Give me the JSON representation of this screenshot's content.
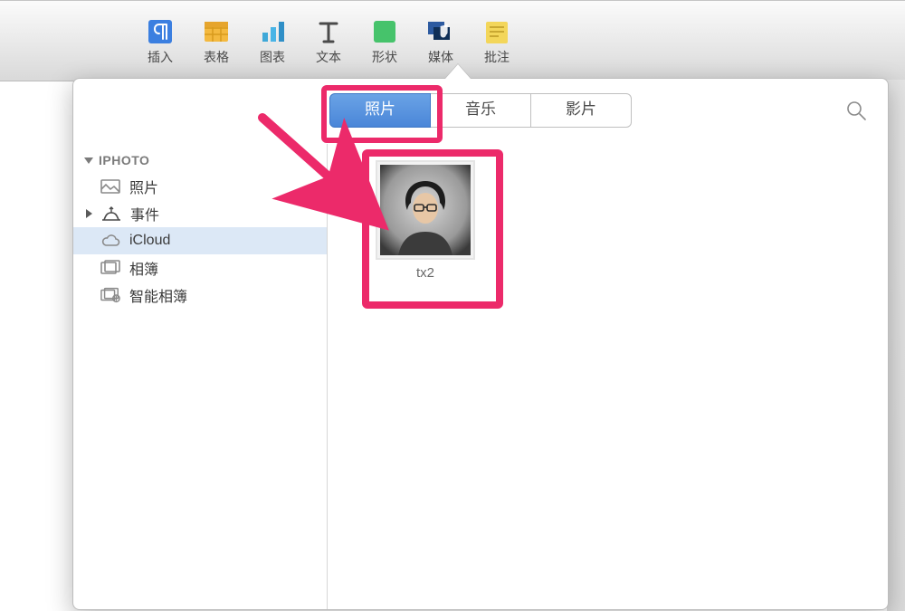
{
  "toolbar": {
    "items": [
      {
        "label": "插入",
        "icon": "pilcrow"
      },
      {
        "label": "表格",
        "icon": "table"
      },
      {
        "label": "图表",
        "icon": "chart"
      },
      {
        "label": "文本",
        "icon": "text"
      },
      {
        "label": "形状",
        "icon": "shape"
      },
      {
        "label": "媒体",
        "icon": "media"
      },
      {
        "label": "批注",
        "icon": "comment"
      }
    ]
  },
  "tabs": {
    "items": [
      {
        "label": "照片",
        "active": true
      },
      {
        "label": "音乐",
        "active": false
      },
      {
        "label": "影片",
        "active": false
      }
    ]
  },
  "sidebar": {
    "header": "IPHOTO",
    "items": [
      {
        "label": "照片",
        "icon": "photo",
        "expandable": false,
        "selected": false
      },
      {
        "label": "事件",
        "icon": "events",
        "expandable": true,
        "selected": false
      },
      {
        "label": "iCloud",
        "icon": "cloud",
        "expandable": false,
        "selected": true
      },
      {
        "label": "相簿",
        "icon": "albums",
        "expandable": false,
        "selected": false
      },
      {
        "label": "智能相簿",
        "icon": "smart-albums",
        "expandable": false,
        "selected": false
      }
    ]
  },
  "content": {
    "thumb_label": "tx2"
  },
  "colors": {
    "highlight": "#ec2a6a",
    "tab_active_bg": "#4a86d8"
  }
}
